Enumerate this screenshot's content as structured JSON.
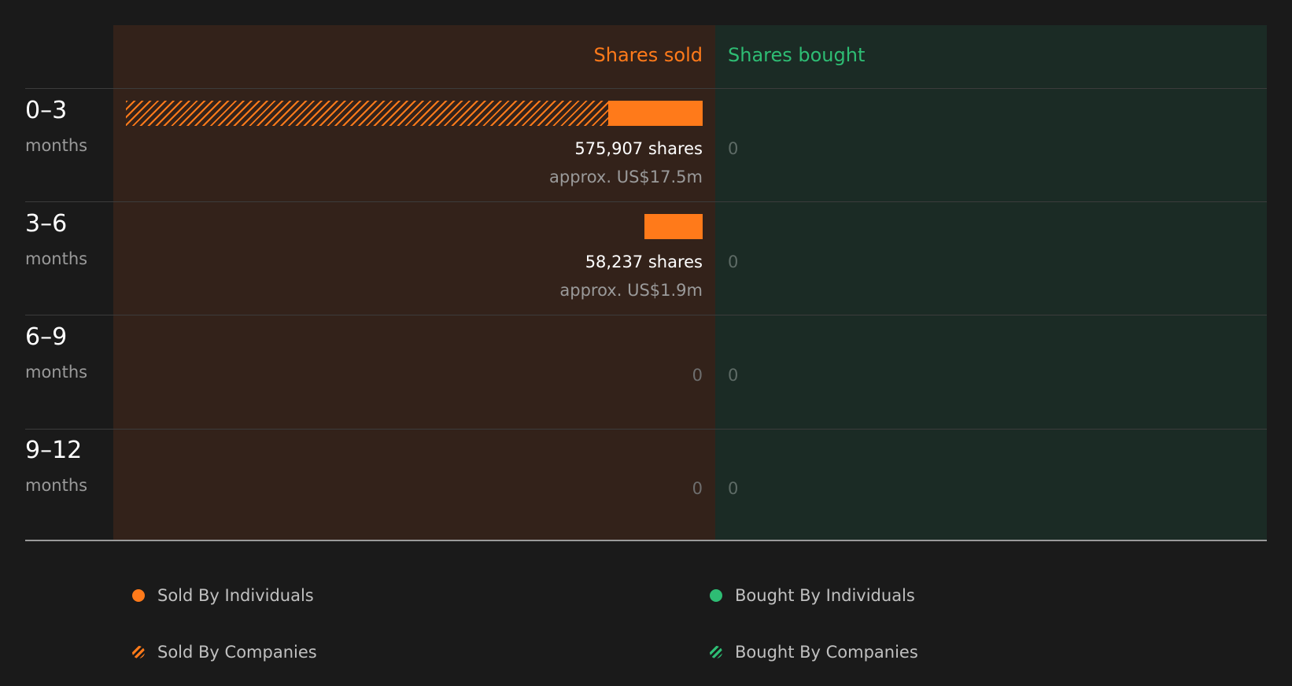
{
  "colors": {
    "sold": "#ff7a1a",
    "bought": "#2ebd74"
  },
  "headers": {
    "sold": "Shares sold",
    "bought": "Shares bought"
  },
  "chart_data": {
    "type": "bar",
    "orientation": "horizontal-diverging",
    "categories": [
      "0–3",
      "3–6",
      "6–9",
      "9–12"
    ],
    "unit_label": "months",
    "series": [
      {
        "name": "Sold By Individuals",
        "side": "sold",
        "values": [
          94000,
          58237,
          0,
          0
        ]
      },
      {
        "name": "Sold By Companies",
        "side": "sold",
        "values": [
          481907,
          0,
          0,
          0
        ]
      },
      {
        "name": "Bought By Individuals",
        "side": "bought",
        "values": [
          0,
          0,
          0,
          0
        ]
      },
      {
        "name": "Bought By Companies",
        "side": "bought",
        "values": [
          0,
          0,
          0,
          0
        ]
      }
    ],
    "sold_totals": [
      "575,907 shares",
      "58,237 shares",
      "0",
      "0"
    ],
    "sold_usd": [
      "approx. US$17.5m",
      "approx. US$1.9m",
      "",
      ""
    ],
    "bought_totals": [
      "0",
      "0",
      "0",
      "0"
    ],
    "xlim": [
      0,
      575907
    ],
    "legend_position": "bottom"
  },
  "legend": [
    {
      "label": "Sold By Individuals"
    },
    {
      "label": "Bought By Individuals"
    },
    {
      "label": "Sold By Companies"
    },
    {
      "label": "Bought By Companies"
    }
  ]
}
